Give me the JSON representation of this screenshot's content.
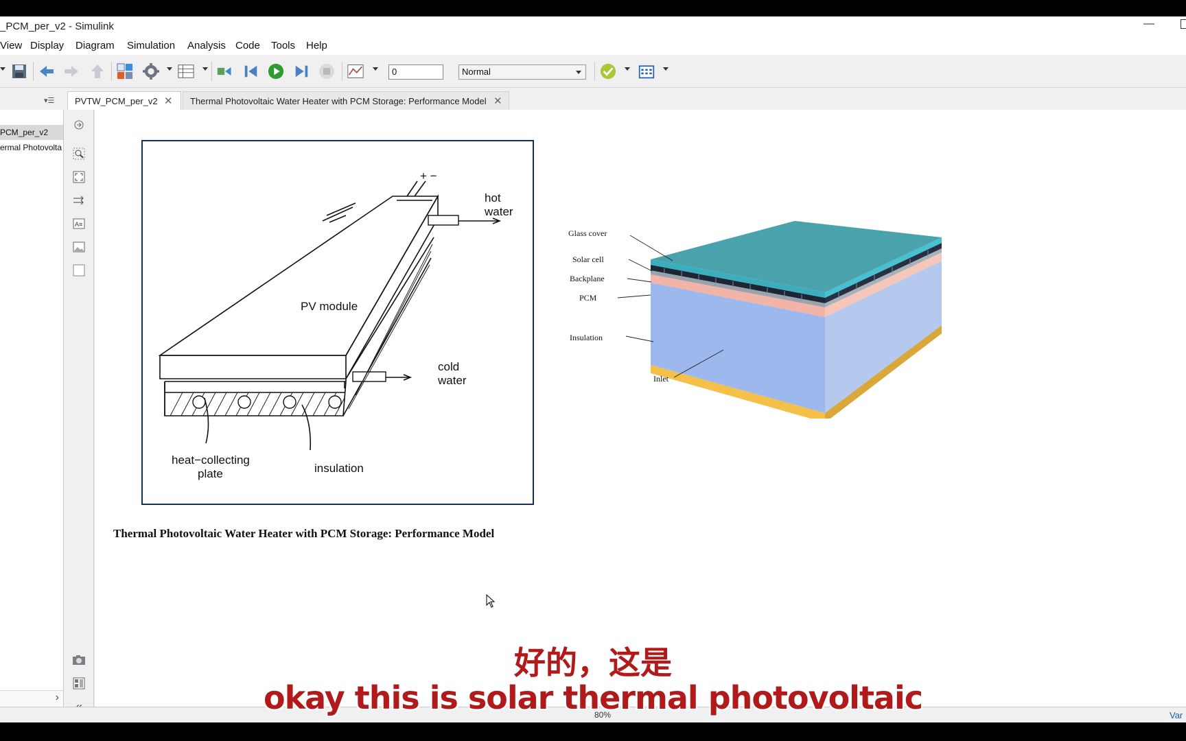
{
  "window": {
    "title": "_PCM_per_v2 - Simulink"
  },
  "menu": [
    "View",
    "Display",
    "Diagram",
    "Simulation",
    "Analysis",
    "Code",
    "Tools",
    "Help"
  ],
  "toolbar": {
    "stop_time": "0",
    "sim_mode": "Normal"
  },
  "tabs": [
    {
      "label": "PVTW_PCM_per_v2"
    },
    {
      "label": "Thermal Photovoltaic Water Heater with PCM Storage: Performance Model"
    }
  ],
  "browser": {
    "items": [
      "PCM_per_v2",
      "ermal Photovolta"
    ]
  },
  "diagram1": {
    "label_plus_minus": "+ −",
    "label_hot": "hot",
    "label_water1": "water",
    "label_pv": "PV  module",
    "label_cold": "cold",
    "label_water2": "water",
    "label_heat1": "heat−collecting",
    "label_heat2": "plate",
    "label_insulation": "insulation"
  },
  "diagram2": {
    "labels": [
      "Glass cover",
      "Solar cell",
      "Backplane",
      "PCM",
      "Insulation",
      "Inlet"
    ]
  },
  "caption": "Thermal Photovoltaic Water Heater with PCM Storage: Performance Model",
  "status": {
    "zoom": "80%",
    "var": "Var"
  },
  "subtitles": {
    "zh": "好的，这是",
    "en": "okay this is solar thermal photovoltaic"
  }
}
